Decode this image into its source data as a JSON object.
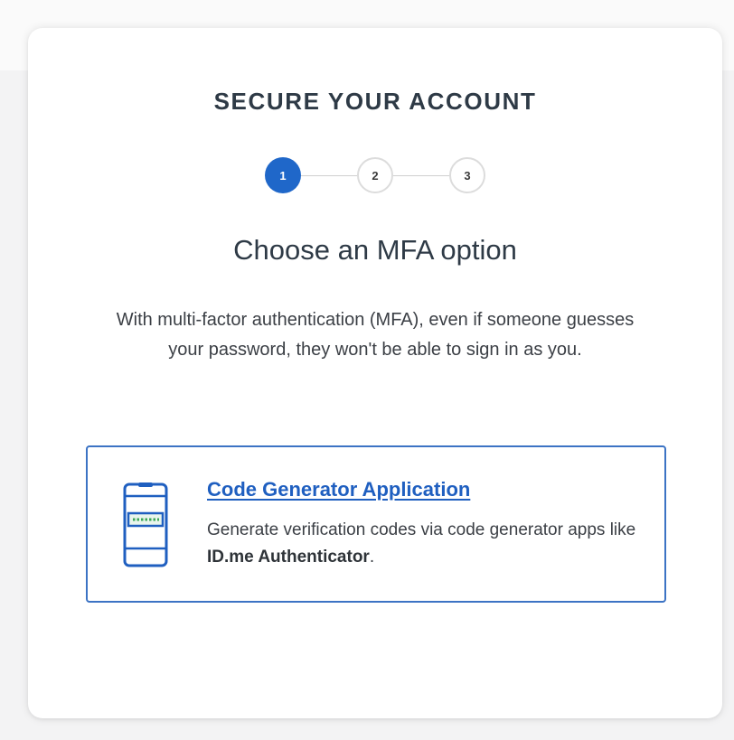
{
  "header": {
    "title": "SECURE YOUR ACCOUNT"
  },
  "stepper": {
    "steps": [
      "1",
      "2",
      "3"
    ],
    "current": 1
  },
  "main": {
    "title": "Choose an MFA option",
    "description": "With multi-factor authentication (MFA), even if someone guesses your password, they won't be able to sign in as you."
  },
  "option": {
    "title": "Code Generator Application",
    "description_prefix": "Generate verification codes via code generator apps like ",
    "description_strong": "ID.me Authenticator",
    "description_suffix": ".",
    "icon": "phone-code-icon"
  },
  "colors": {
    "accent": "#1f67c9",
    "link": "#1f5fc0",
    "option_border": "#3c73c4",
    "text": "#2e3a46"
  }
}
